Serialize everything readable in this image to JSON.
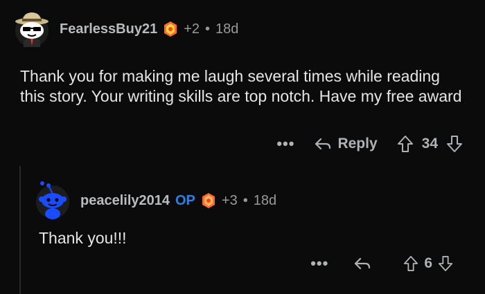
{
  "comments": [
    {
      "username": "FearlessBuy21",
      "op": "",
      "awards": "+2",
      "separator": "•",
      "time": "18d",
      "text": "Thank you for making me laugh several times while reading this story. Your writing skills are top notch. Have my free award",
      "more": "•••",
      "reply_label": "Reply",
      "score": "34"
    },
    {
      "username": "peacelily2014",
      "op": "OP",
      "awards": "+3",
      "separator": "•",
      "time": "18d",
      "text": "Thank you!!!",
      "more": "•••",
      "reply_label": "",
      "score": "6"
    }
  ],
  "colors": {
    "background": "#0b0b0b",
    "op_badge": "#2f7fe0",
    "snoo_blue": "#1a4cff"
  }
}
